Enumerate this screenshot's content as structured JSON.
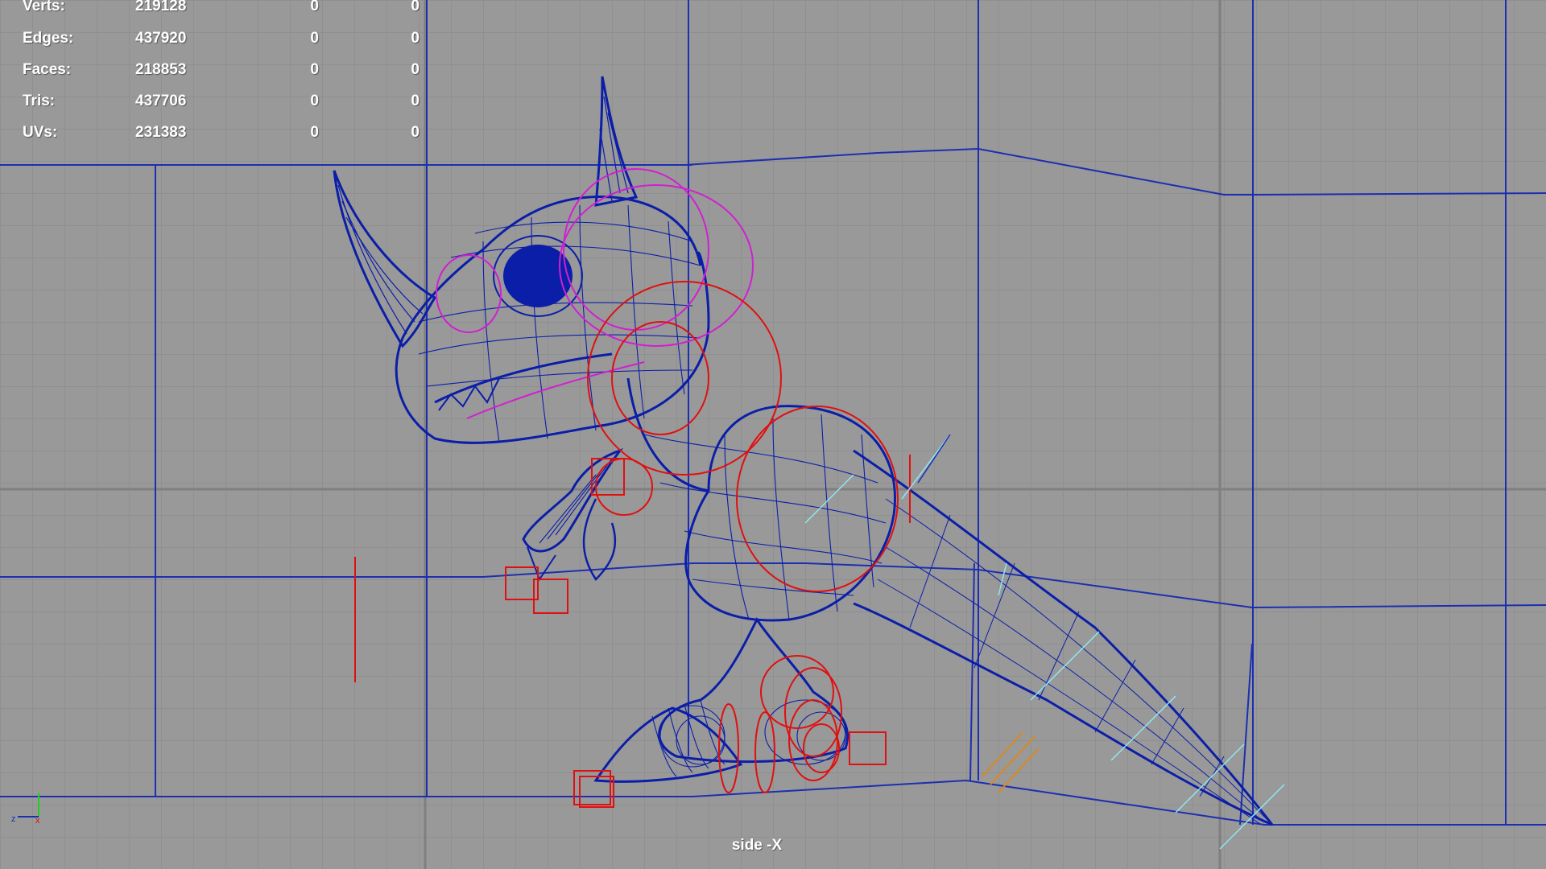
{
  "hud": {
    "rows": [
      {
        "label": "Verts:",
        "total": "219128",
        "selected": "0",
        "highlight": "0"
      },
      {
        "label": "Edges:",
        "total": "437920",
        "selected": "0",
        "highlight": "0"
      },
      {
        "label": "Faces:",
        "total": "218853",
        "selected": "0",
        "highlight": "0"
      },
      {
        "label": "Tris:",
        "total": "437706",
        "selected": "0",
        "highlight": "0"
      },
      {
        "label": "UVs:",
        "total": "231383",
        "selected": "0",
        "highlight": "0"
      }
    ]
  },
  "camera_label": "side -X",
  "axis_indicator": {
    "x": "x",
    "z": "z"
  },
  "colors": {
    "background": "#999999",
    "grid_minor": "#8a8a8a",
    "grid_major": "#1c2fb0",
    "wireframe": "#0b1ea8",
    "controls_red": "#e01010",
    "controls_magenta": "#d020d0",
    "joints_cyan": "#8fe8f0",
    "joints_orange": "#d88a20",
    "text": "#ffffff"
  }
}
